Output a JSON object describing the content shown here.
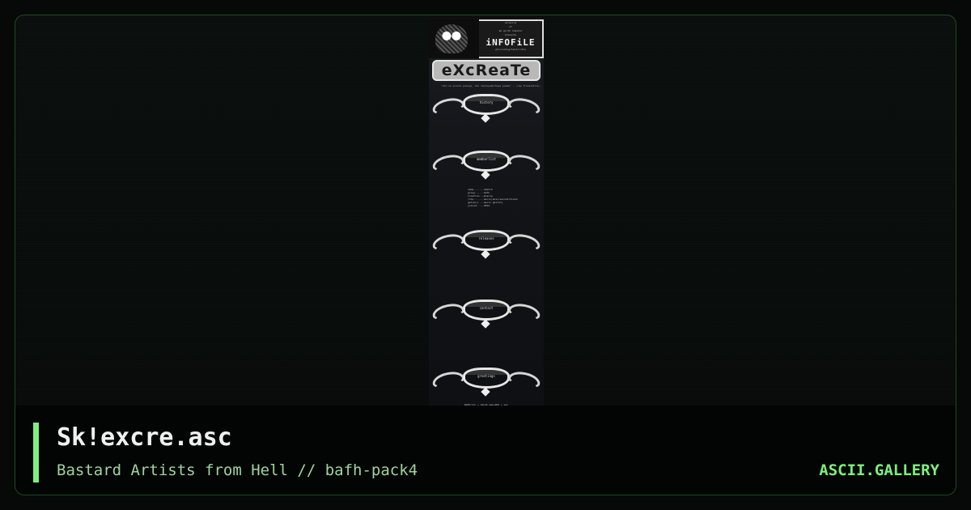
{
  "caption": {
    "title": "Sk!excre.asc",
    "subtitle": "Bastard Artists from Hell // bafh-pack4",
    "brand": "ASCII.GALLERY"
  },
  "artwork": {
    "header_infofile": "iNFOFiLE",
    "header_small_lines": [
      "sk!excre",
      "of",
      "ab  glcth  rmaster",
      "presents",
      "gfx/coding/text/infos"
    ],
    "logo": "eXcReaTe",
    "quote": "\"eto ne prosto pesnya, eto nastoyashchaya poema\" - ~raw translation~",
    "sections": [
      "history",
      "memberlist",
      "releases",
      "contact",
      "greetings"
    ],
    "stats": [
      "name.......sketch",
      "group......bafh",
      "location...moscow",
      "role.......ascii/ansi/sunsetroland",
      "gallery....ascii.gallery",
      "joined.....2012"
    ],
    "footer": "BAFH(tm) + ASCII.GALLERY + etc"
  },
  "colors": {
    "accent": "#7df07d",
    "frame_border": "#1f4a24",
    "background": "#060908"
  },
  "icons": {
    "accent": "accent-bar"
  }
}
